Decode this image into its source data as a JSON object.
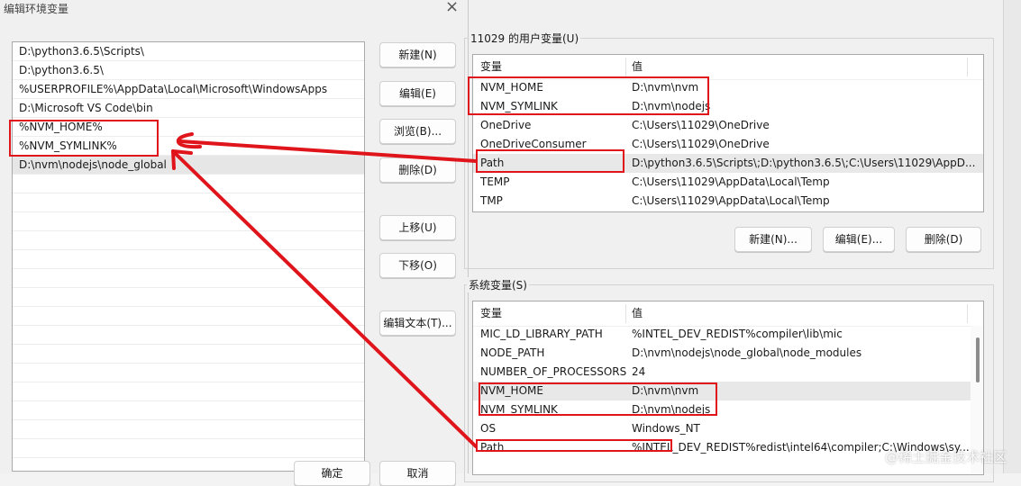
{
  "edit_dialog": {
    "title": "编辑环境变量",
    "close": "×",
    "paths": [
      "D:\\python3.6.5\\Scripts\\",
      "D:\\python3.6.5\\",
      "%USERPROFILE%\\AppData\\Local\\Microsoft\\WindowsApps",
      "D:\\Microsoft VS Code\\bin",
      "%NVM_HOME%",
      "%NVM_SYMLINK%",
      "D:\\nvm\\nodejs\\node_global"
    ],
    "selected_index": 6,
    "buttons": {
      "new": "新建(N)",
      "edit": "编辑(E)",
      "browse": "浏览(B)...",
      "delete": "删除(D)",
      "move_up": "上移(U)",
      "move_down": "下移(O)",
      "edit_text": "编辑文本(T)...",
      "ok": "确定",
      "cancel": "取消"
    }
  },
  "env_dialog": {
    "user_vars": {
      "label": "11029 的用户变量(U)",
      "col_name": "变量",
      "col_value": "值",
      "rows": [
        {
          "name": "NVM_HOME",
          "value": "D:\\nvm\\nvm"
        },
        {
          "name": "NVM_SYMLINK",
          "value": "D:\\nvm\\nodejs"
        },
        {
          "name": "OneDrive",
          "value": "C:\\Users\\11029\\OneDrive"
        },
        {
          "name": "OneDriveConsumer",
          "value": "C:\\Users\\11029\\OneDrive"
        },
        {
          "name": "Path",
          "value": "D:\\python3.6.5\\Scripts\\;D:\\python3.6.5\\;C:\\Users\\11029\\AppD..."
        },
        {
          "name": "TEMP",
          "value": "C:\\Users\\11029\\AppData\\Local\\Temp"
        },
        {
          "name": "TMP",
          "value": "C:\\Users\\11029\\AppData\\Local\\Temp"
        }
      ],
      "selected_index": 4,
      "buttons": {
        "new": "新建(N)...",
        "edit": "编辑(E)...",
        "delete": "删除(D)"
      }
    },
    "system_vars": {
      "label": "系统变量(S)",
      "col_name": "变量",
      "col_value": "值",
      "rows": [
        {
          "name": "MIC_LD_LIBRARY_PATH",
          "value": "%INTEL_DEV_REDIST%compiler\\lib\\mic"
        },
        {
          "name": "NODE_PATH",
          "value": "D:\\nvm\\nodejs\\node_global\\node_modules"
        },
        {
          "name": "NUMBER_OF_PROCESSORS",
          "value": "24"
        },
        {
          "name": "NVM_HOME",
          "value": "D:\\nvm\\nvm"
        },
        {
          "name": "NVM_SYMLINK",
          "value": "D:\\nvm\\nodejs"
        },
        {
          "name": "OS",
          "value": "Windows_NT"
        },
        {
          "name": "Path",
          "value": "%INTEL_DEV_REDIST%redist\\intel64\\compiler;C:\\Windows\\sy..."
        }
      ],
      "selected_index": 3
    }
  },
  "watermark": "@稀土掘金技术社区",
  "colors": {
    "annotation_red": "#e0151b",
    "selection": "#e6e6e6",
    "dialog_bg": "#f0f0f0"
  }
}
